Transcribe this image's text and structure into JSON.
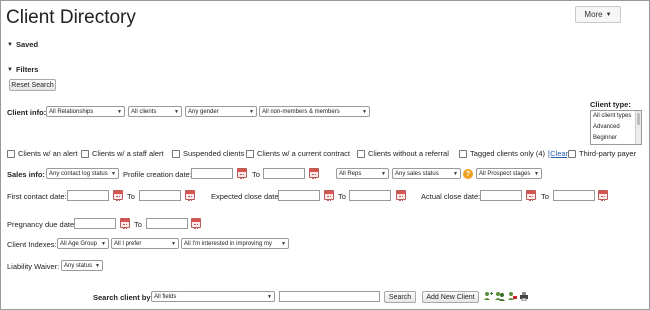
{
  "header": {
    "title": "Client Directory",
    "more_label": "More"
  },
  "sections": {
    "saved_label": "Saved",
    "filters_label": "Filters"
  },
  "reset_label": "Reset Search",
  "client_info": {
    "label": "Client info:",
    "relationships": "All Relationships",
    "clients": "All clients",
    "gender": "Any gender",
    "membership": "All non-members & members"
  },
  "client_type": {
    "label": "Client type:",
    "options": [
      "All client types",
      "Advanced",
      "Beginner",
      "..."
    ]
  },
  "checkboxes": {
    "alert": "Clients w/ an alert",
    "staff_alert": "Clients w/ a staff alert",
    "suspended": "Suspended clients",
    "current_contract": "Clients w/ a current contract",
    "without_referral": "Clients without a referral",
    "tagged": "Tagged clients only (4)",
    "clear": "[Clear]",
    "third_party": "Third-party payer"
  },
  "sales_info": {
    "label": "Sales info:",
    "contact_log": "Any contact log status",
    "profile_creation_label": "Profile creation date:",
    "to_label": "To",
    "reps": "All Reps",
    "sales_status": "Any sales status",
    "prospect_stages": "All Prospect stages"
  },
  "dates": {
    "first_contact_label": "First contact date:",
    "expected_close_label": "Expected close date:",
    "actual_close_label": "Actual close date:",
    "pregnancy_due_label": "Pregnancy due date:",
    "to_label": "To"
  },
  "client_indexes": {
    "label": "Client Indexes:",
    "age_group": "All Age Group",
    "prefer": "All I prefer",
    "interested": "All I'm interested in improving my"
  },
  "liability": {
    "label": "Liability Waiver:",
    "status": "Any status"
  },
  "search": {
    "label": "Search client by",
    "field": "All fields",
    "value": "",
    "search_label": "Search",
    "add_label": "Add New Client"
  }
}
